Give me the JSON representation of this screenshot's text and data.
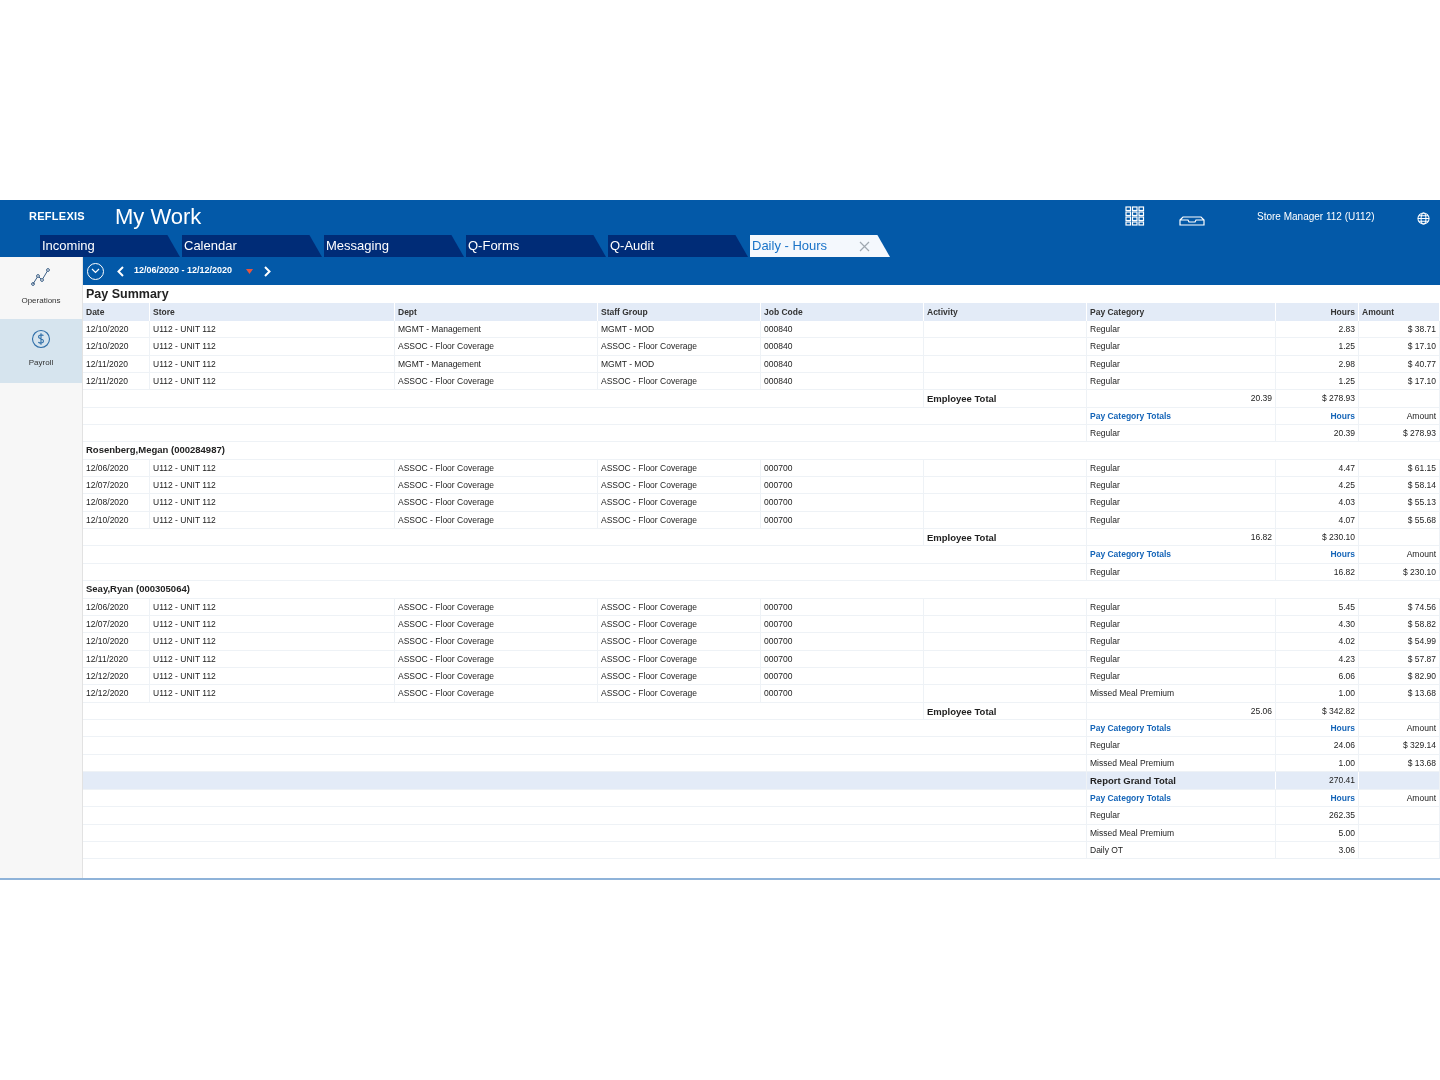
{
  "app": {
    "logo": "REFLEXIS",
    "title": "My Work",
    "user": "Store Manager 112 (U112)"
  },
  "tabs": [
    {
      "label": "Incoming",
      "selected": false
    },
    {
      "label": "Calendar",
      "selected": false
    },
    {
      "label": "Messaging",
      "selected": false
    },
    {
      "label": "Q-Forms",
      "selected": false
    },
    {
      "label": "Q-Audit",
      "selected": false
    },
    {
      "label": "Daily - Hours",
      "selected": true
    }
  ],
  "toolbar": {
    "date_range": "12/06/2020 - 12/12/2020"
  },
  "sidebar": {
    "items": [
      {
        "label": "Operations",
        "selected": false,
        "kind": "chart"
      },
      {
        "label": "Payroll",
        "selected": true,
        "kind": "dollar"
      }
    ]
  },
  "report": {
    "title": "Pay Summary",
    "columns": [
      "Date",
      "Store",
      "Dept",
      "Staff Group",
      "Job Code",
      "Activity",
      "Pay Category",
      "Hours",
      "Amount"
    ],
    "groups": [
      {
        "rows": [
          {
            "date": "12/10/2020",
            "store": "U112 - UNIT 112",
            "dept": "MGMT - Management",
            "staff_group": "MGMT - MOD",
            "job_code": "000840",
            "pay_category": "Regular",
            "hours": "2.83",
            "amount": "$ 38.71"
          },
          {
            "date": "12/10/2020",
            "store": "U112 - UNIT 112",
            "dept": "ASSOC - Floor Coverage",
            "staff_group": "ASSOC - Floor Coverage",
            "job_code": "000840",
            "pay_category": "Regular",
            "hours": "1.25",
            "amount": "$ 17.10"
          },
          {
            "date": "12/11/2020",
            "store": "U112 - UNIT 112",
            "dept": "MGMT - Management",
            "staff_group": "MGMT - MOD",
            "job_code": "000840",
            "pay_category": "Regular",
            "hours": "2.98",
            "amount": "$ 40.77"
          },
          {
            "date": "12/11/2020",
            "store": "U112 - UNIT 112",
            "dept": "ASSOC - Floor Coverage",
            "staff_group": "ASSOC - Floor Coverage",
            "job_code": "000840",
            "pay_category": "Regular",
            "hours": "1.25",
            "amount": "$ 17.10"
          }
        ],
        "total": {
          "label": "Employee Total",
          "hours": "20.39",
          "amount": "$ 278.93"
        },
        "category_totals": {
          "heading": "Pay Category Totals",
          "hours_heading": "Hours",
          "amount_heading": "Amount",
          "rows": [
            {
              "category": "Regular",
              "hours": "20.39",
              "amount": "$ 278.93"
            }
          ]
        }
      },
      {
        "employee": "Rosenberg,Megan (000284987)",
        "rows": [
          {
            "date": "12/06/2020",
            "store": "U112 - UNIT 112",
            "dept": "ASSOC - Floor Coverage",
            "staff_group": "ASSOC - Floor Coverage",
            "job_code": "000700",
            "pay_category": "Regular",
            "hours": "4.47",
            "amount": "$ 61.15"
          },
          {
            "date": "12/07/2020",
            "store": "U112 - UNIT 112",
            "dept": "ASSOC - Floor Coverage",
            "staff_group": "ASSOC - Floor Coverage",
            "job_code": "000700",
            "pay_category": "Regular",
            "hours": "4.25",
            "amount": "$ 58.14"
          },
          {
            "date": "12/08/2020",
            "store": "U112 - UNIT 112",
            "dept": "ASSOC - Floor Coverage",
            "staff_group": "ASSOC - Floor Coverage",
            "job_code": "000700",
            "pay_category": "Regular",
            "hours": "4.03",
            "amount": "$ 55.13"
          },
          {
            "date": "12/10/2020",
            "store": "U112 - UNIT 112",
            "dept": "ASSOC - Floor Coverage",
            "staff_group": "ASSOC - Floor Coverage",
            "job_code": "000700",
            "pay_category": "Regular",
            "hours": "4.07",
            "amount": "$ 55.68"
          }
        ],
        "total": {
          "label": "Employee Total",
          "hours": "16.82",
          "amount": "$ 230.10"
        },
        "category_totals": {
          "heading": "Pay Category Totals",
          "hours_heading": "Hours",
          "amount_heading": "Amount",
          "rows": [
            {
              "category": "Regular",
              "hours": "16.82",
              "amount": "$ 230.10"
            }
          ]
        }
      },
      {
        "employee": "Seay,Ryan (000305064)",
        "rows": [
          {
            "date": "12/06/2020",
            "store": "U112 - UNIT 112",
            "dept": "ASSOC - Floor Coverage",
            "staff_group": "ASSOC - Floor Coverage",
            "job_code": "000700",
            "pay_category": "Regular",
            "hours": "5.45",
            "amount": "$ 74.56"
          },
          {
            "date": "12/07/2020",
            "store": "U112 - UNIT 112",
            "dept": "ASSOC - Floor Coverage",
            "staff_group": "ASSOC - Floor Coverage",
            "job_code": "000700",
            "pay_category": "Regular",
            "hours": "4.30",
            "amount": "$ 58.82"
          },
          {
            "date": "12/10/2020",
            "store": "U112 - UNIT 112",
            "dept": "ASSOC - Floor Coverage",
            "staff_group": "ASSOC - Floor Coverage",
            "job_code": "000700",
            "pay_category": "Regular",
            "hours": "4.02",
            "amount": "$ 54.99"
          },
          {
            "date": "12/11/2020",
            "store": "U112 - UNIT 112",
            "dept": "ASSOC - Floor Coverage",
            "staff_group": "ASSOC - Floor Coverage",
            "job_code": "000700",
            "pay_category": "Regular",
            "hours": "4.23",
            "amount": "$ 57.87"
          },
          {
            "date": "12/12/2020",
            "store": "U112 - UNIT 112",
            "dept": "ASSOC - Floor Coverage",
            "staff_group": "ASSOC - Floor Coverage",
            "job_code": "000700",
            "pay_category": "Regular",
            "hours": "6.06",
            "amount": "$ 82.90"
          },
          {
            "date": "12/12/2020",
            "store": "U112 - UNIT 112",
            "dept": "ASSOC - Floor Coverage",
            "staff_group": "ASSOC - Floor Coverage",
            "job_code": "000700",
            "pay_category": "Missed Meal Premium",
            "hours": "1.00",
            "amount": "$ 13.68"
          }
        ],
        "total": {
          "label": "Employee Total",
          "hours": "25.06",
          "amount": "$ 342.82"
        },
        "category_totals": {
          "heading": "Pay Category Totals",
          "hours_heading": "Hours",
          "amount_heading": "Amount",
          "rows": [
            {
              "category": "Regular",
              "hours": "24.06",
              "amount": "$ 329.14"
            },
            {
              "category": "Missed Meal Premium",
              "hours": "1.00",
              "amount": "$ 13.68"
            }
          ]
        }
      }
    ],
    "grand_total": {
      "label": "Report Grand Total",
      "hours": "270.41"
    },
    "grand_category_totals": {
      "heading": "Pay Category Totals",
      "hours_heading": "Hours",
      "amount_heading": "Amount",
      "rows": [
        {
          "category": "Regular",
          "hours": "262.35"
        },
        {
          "category": "Missed Meal Premium",
          "hours": "5.00"
        },
        {
          "category": "Daily OT",
          "hours": "3.06"
        }
      ]
    }
  }
}
